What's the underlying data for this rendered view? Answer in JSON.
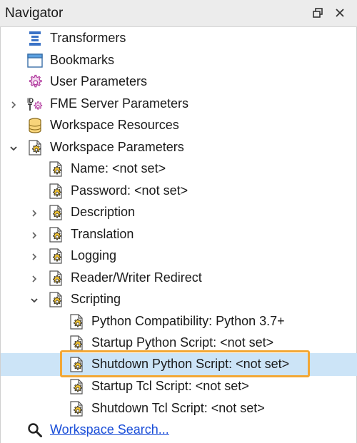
{
  "panel": {
    "title": "Navigator"
  },
  "tree": {
    "transformers": "Transformers",
    "bookmarks": "Bookmarks",
    "user_parameters": "User Parameters",
    "fme_server_parameters": "FME Server Parameters",
    "workspace_resources": "Workspace Resources",
    "workspace_parameters": "Workspace Parameters",
    "name": "Name: <not set>",
    "password": "Password: <not set>",
    "description": "Description",
    "translation": "Translation",
    "logging": "Logging",
    "reader_writer_redirect": "Reader/Writer Redirect",
    "scripting": "Scripting",
    "python_compatibility": "Python Compatibility: Python 3.7+",
    "startup_python_script": "Startup Python Script: <not set>",
    "shutdown_python_script": "Shutdown Python Script: <not set>",
    "startup_tcl_script": "Startup Tcl Script: <not set>",
    "shutdown_tcl_script": "Shutdown Tcl Script: <not set>",
    "workspace_search": "Workspace Search..."
  },
  "colors": {
    "selection": "#cce4f7",
    "highlight_outline": "#f2a735",
    "link": "#1a4ed8"
  }
}
